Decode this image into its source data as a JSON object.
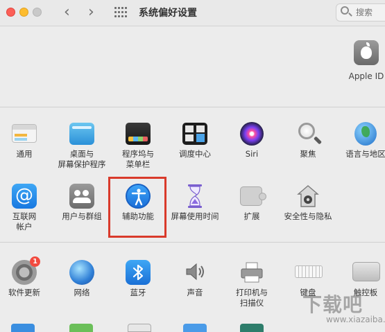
{
  "window": {
    "title": "系统偏好设置",
    "search_placeholder": "搜索",
    "nav_back": "‹",
    "nav_forward": "›"
  },
  "apple_id": {
    "label": "Apple ID"
  },
  "rows": {
    "row1": [
      {
        "label": "通用",
        "icon": "general-icon"
      },
      {
        "label": "桌面与\n屏幕保护程序",
        "icon": "desktop-screensaver-icon"
      },
      {
        "label": "程序坞与\n菜单栏",
        "icon": "dock-menubar-icon"
      },
      {
        "label": "调度中心",
        "icon": "mission-control-icon"
      },
      {
        "label": "Siri",
        "icon": "siri-icon"
      },
      {
        "label": "聚焦",
        "icon": "spotlight-icon"
      },
      {
        "label": "语言与地区",
        "icon": "language-region-icon"
      }
    ],
    "row2": [
      {
        "label": "互联网\n帐户",
        "icon": "internet-accounts-icon"
      },
      {
        "label": "用户与群组",
        "icon": "users-groups-icon"
      },
      {
        "label": "辅助功能",
        "icon": "accessibility-icon"
      },
      {
        "label": "屏幕使用时间",
        "icon": "screen-time-icon"
      },
      {
        "label": "扩展",
        "icon": "extensions-icon"
      },
      {
        "label": "安全性与隐私",
        "icon": "security-privacy-icon"
      }
    ],
    "row3": [
      {
        "label": "软件更新",
        "icon": "software-update-icon",
        "badge": "1"
      },
      {
        "label": "网络",
        "icon": "network-icon"
      },
      {
        "label": "蓝牙",
        "icon": "bluetooth-icon"
      },
      {
        "label": "声音",
        "icon": "sound-icon"
      },
      {
        "label": "打印机与\n扫描仪",
        "icon": "printers-scanners-icon"
      },
      {
        "label": "键盘",
        "icon": "keyboard-icon"
      },
      {
        "label": "触控板",
        "icon": "trackpad-icon"
      }
    ]
  },
  "colors": {
    "highlight": "#d93a2b",
    "accent_blue": "#1a70d6"
  },
  "watermark": {
    "text": "下载吧",
    "url": "www.xiazaiba.com"
  }
}
